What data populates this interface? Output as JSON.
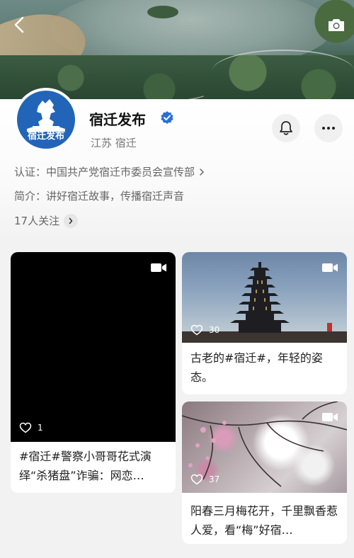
{
  "account": {
    "name": "宿迁发布",
    "location": "江苏 宿迁",
    "avatar_text": "宿迁发布",
    "certification": "认证：中国共产党宿迁市委员会宣传部",
    "intro": "简介：讲好宿迁故事，传播宿迁声音",
    "following": "17人关注"
  },
  "icons": {
    "back": "back-arrow-icon",
    "camera": "camera-icon",
    "verified": "verified-badge-icon",
    "bell": "bell-icon",
    "more": "more-dots-icon",
    "video": "video-camera-icon",
    "like": "heart-icon"
  },
  "colors": {
    "verified_blue": "#2a6fd6",
    "avatar_blue": "#2265b8"
  },
  "posts": [
    {
      "title": "#宿迁#警察小哥哥花式演绎“杀猪盘”诈骗：网恋…",
      "likes": "1",
      "is_video": true
    },
    {
      "title": "古老的#宿迁#，年轻的姿态。",
      "likes": "30",
      "is_video": true
    },
    {
      "title": "阳春三月梅花开，千里飘香惹人爱，看“梅”好宿…",
      "likes": "37",
      "is_video": true
    }
  ]
}
